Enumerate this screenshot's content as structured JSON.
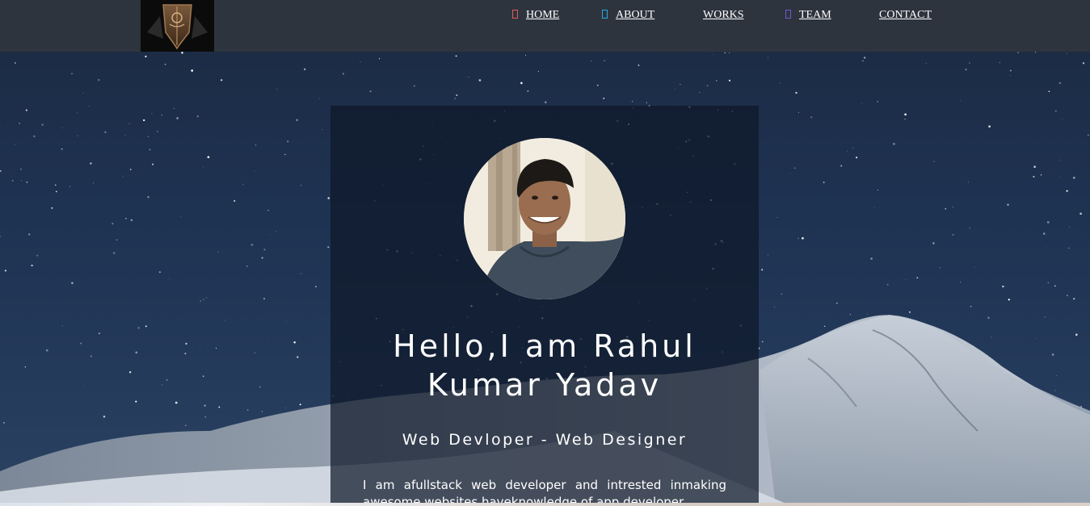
{
  "header": {
    "logo_icon": "shield-crest-icon",
    "nav": [
      {
        "label": "HOME",
        "icon": "home-icon",
        "icon_color": "#e05a5a"
      },
      {
        "label": "ABOUT",
        "icon": "user-icon",
        "icon_color": "#27a9e1"
      },
      {
        "label": "WORKS",
        "icon": "",
        "icon_color": ""
      },
      {
        "label": "TEAM",
        "icon": "team-icon",
        "icon_color": "#6b5bd6"
      },
      {
        "label": "CONTACT",
        "icon": "",
        "icon_color": ""
      }
    ]
  },
  "hero": {
    "title": "Hello,I am Rahul Kumar Yadav",
    "subtitle": "Web Devloper - Web Designer",
    "bio": "I am afullstack web developer and intrested inmaking awesome websites.haveknowledge of app developer"
  },
  "colors": {
    "header_bg": "#2e343e",
    "text": "#ffffff"
  }
}
